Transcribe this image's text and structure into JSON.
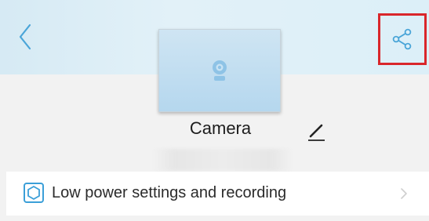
{
  "header": {
    "back_icon": "chevron-left-icon",
    "share_icon": "share-icon",
    "accent_color": "#4aa5d8",
    "highlight_color": "#d9262b"
  },
  "device": {
    "name": "Camera",
    "thumbnail_icon": "camera-icon",
    "edit_icon": "pencil-icon"
  },
  "settings": {
    "items": [
      {
        "label": "Low power settings and recording",
        "icon": "power-settings-icon",
        "chevron_icon": "chevron-right-icon"
      }
    ]
  }
}
